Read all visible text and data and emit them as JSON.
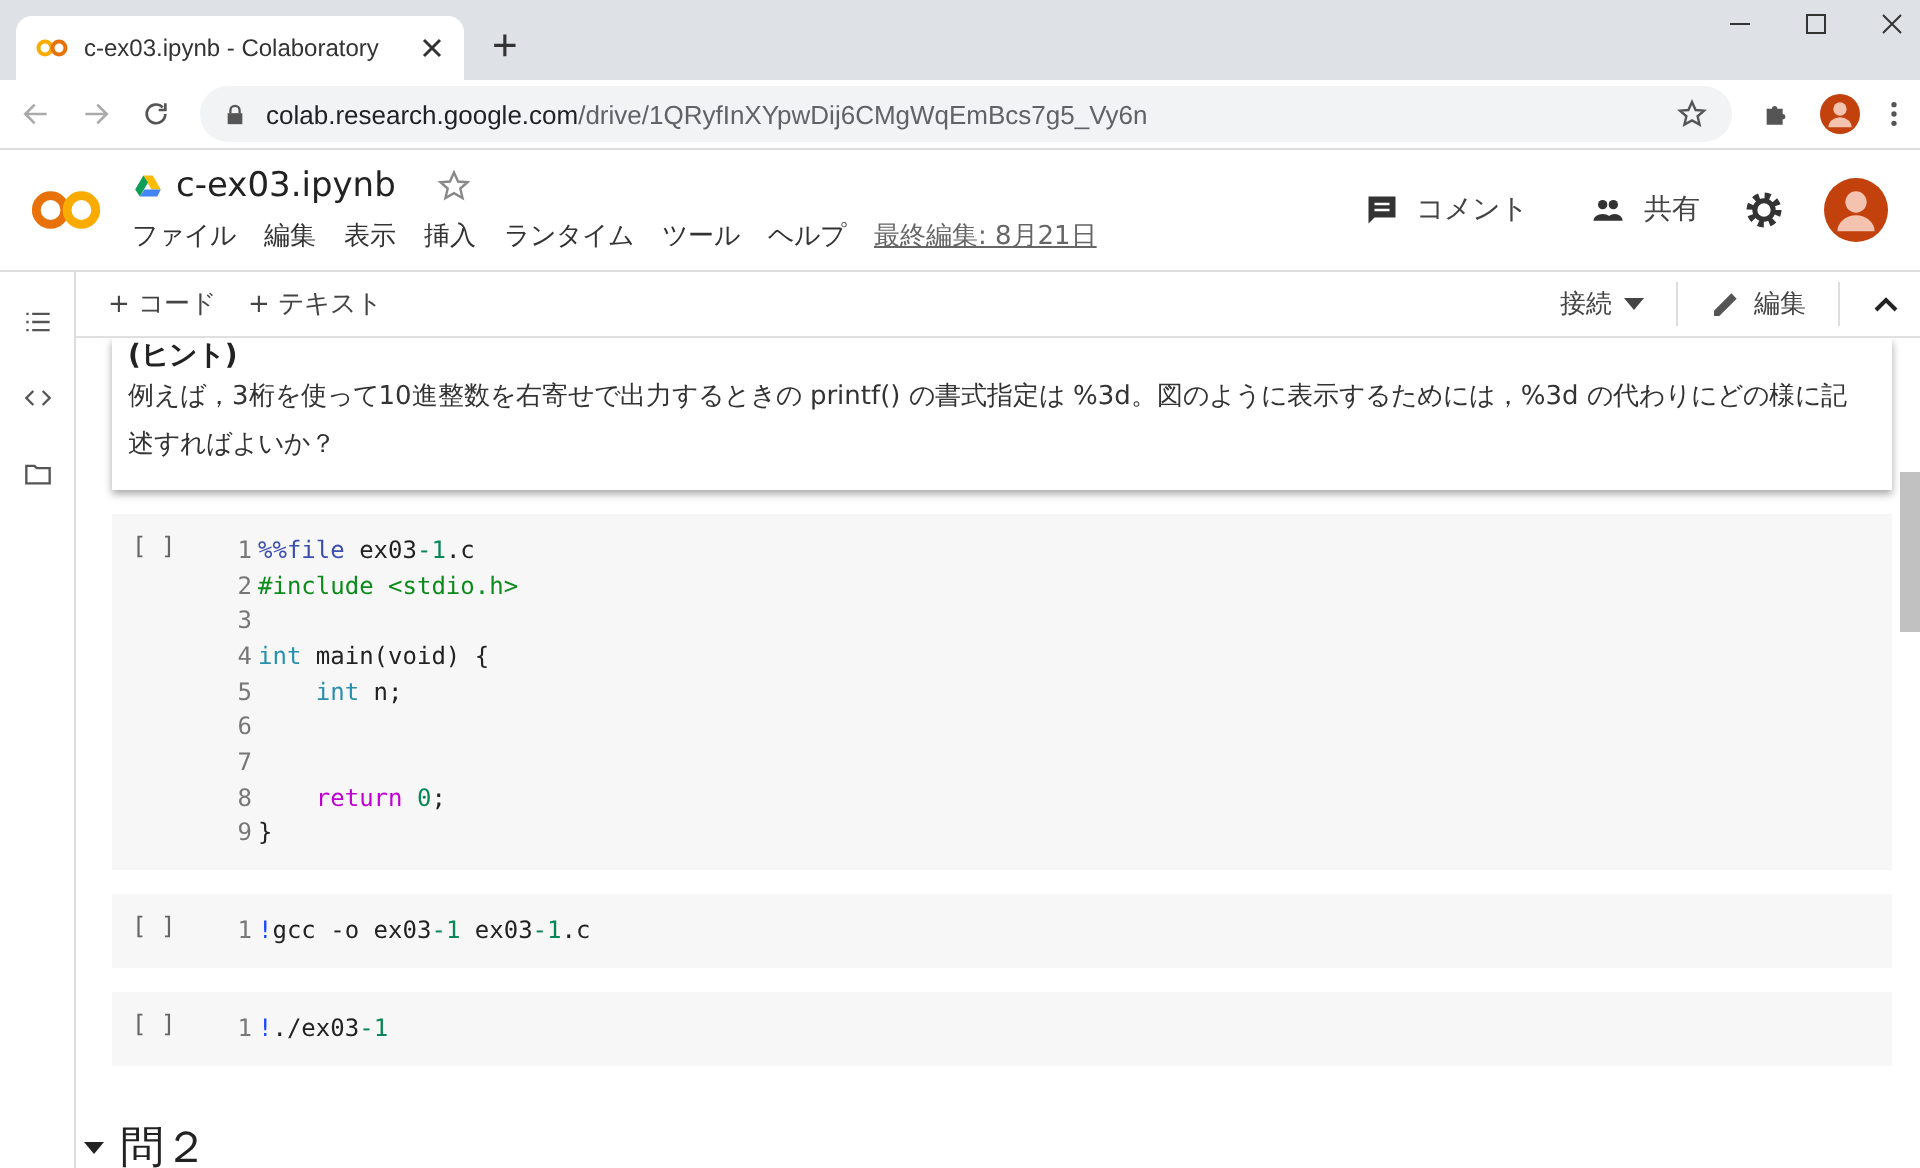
{
  "browser": {
    "tab_title": "c-ex03.ipynb - Colaboratory",
    "new_tab": "+",
    "url_host": "colab.research.google.com",
    "url_path": "/drive/1QRyfInXYpwDij6CMgWqEmBcs7g5_Vy6n"
  },
  "header": {
    "notebook_name": "c-ex03.ipynb",
    "starred": false,
    "menu": [
      "ファイル",
      "編集",
      "表示",
      "挿入",
      "ランタイム",
      "ツール",
      "ヘルプ"
    ],
    "last_edit": "最終編集: 8月21日",
    "comment": "コメント",
    "share": "共有"
  },
  "toolbar": {
    "add_code": "+ コード",
    "add_text": "+ テキスト",
    "connect": "接続",
    "edit": "編集"
  },
  "text_cell": {
    "heading": "(ヒント)",
    "body": "例えば，3桁を使って10進整数を右寄せで出力するときの printf() の書式指定は %3d。図のように表示するためには，%3d の代わりにどの様に記述すればよいか？"
  },
  "code_cells": [
    {
      "run_label": "[ ]",
      "lines": [
        {
          "number": "1",
          "code": [
            {
              "text": "%%file",
              "kind": "magic"
            },
            {
              "text": " ex03",
              "kind": "plain"
            },
            {
              "text": "-1",
              "kind": "number"
            },
            {
              "text": ".c",
              "kind": "plain"
            }
          ]
        },
        {
          "number": "2",
          "code": [
            {
              "text": "#include <stdio.h>",
              "kind": "preproc"
            }
          ]
        },
        {
          "number": "3"
        },
        {
          "number": "4",
          "code": [
            {
              "text": "int",
              "kind": "type"
            },
            {
              "text": " main(void) {",
              "kind": "plain"
            }
          ]
        },
        {
          "number": "5",
          "code": [
            {
              "text": "    int",
              "kind": "type"
            },
            {
              "text": " n;",
              "kind": "plain"
            }
          ]
        },
        {
          "number": "6"
        },
        {
          "number": "7"
        },
        {
          "number": "8",
          "code": [
            {
              "text": "    return",
              "kind": "keyword"
            },
            {
              "text": " 0",
              "kind": "number"
            },
            {
              "text": ";",
              "kind": "plain"
            }
          ]
        },
        {
          "number": "9",
          "code": [
            {
              "text": "}",
              "kind": "plain"
            }
          ]
        }
      ]
    },
    {
      "run_label": "[ ]",
      "lines": [
        {
          "number": "1",
          "code": [
            {
              "text": "!",
              "kind": "bang"
            },
            {
              "text": "gcc -o ex03",
              "kind": "plain"
            },
            {
              "text": "-1",
              "kind": "number"
            },
            {
              "text": " ex03",
              "kind": "plain"
            },
            {
              "text": "-1",
              "kind": "number"
            },
            {
              "text": ".c",
              "kind": "plain"
            }
          ]
        }
      ]
    },
    {
      "run_label": "[ ]",
      "lines": [
        {
          "number": "1",
          "code": [
            {
              "text": "!",
              "kind": "bang"
            },
            {
              "text": "./ex03",
              "kind": "plain"
            },
            {
              "text": "-1",
              "kind": "number"
            }
          ]
        }
      ]
    }
  ],
  "section": {
    "title": "問２",
    "expanded": true
  }
}
